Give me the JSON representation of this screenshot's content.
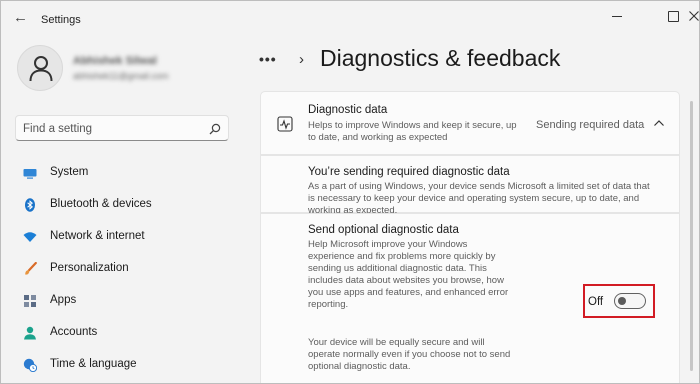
{
  "window": {
    "title": "Settings"
  },
  "profile": {
    "name": "Abhishek Silwal",
    "email": "abhishek11@gmail.com"
  },
  "search": {
    "placeholder": "Find a setting"
  },
  "sidebar": {
    "items": [
      {
        "label": "System",
        "icon": "monitor-icon",
        "color": "#2f86d6"
      },
      {
        "label": "Bluetooth & devices",
        "icon": "bluetooth-icon",
        "color": "#1a73c9"
      },
      {
        "label": "Network & internet",
        "icon": "wifi-icon",
        "color": "#1b7fd6"
      },
      {
        "label": "Personalization",
        "icon": "brush-icon",
        "color": "#e07a33"
      },
      {
        "label": "Apps",
        "icon": "apps-icon",
        "color": "#5a6b85"
      },
      {
        "label": "Accounts",
        "icon": "person-icon",
        "color": "#1aa28c"
      },
      {
        "label": "Time & language",
        "icon": "globe-clock-icon",
        "color": "#2b7bd0"
      }
    ]
  },
  "page": {
    "title": "Diagnostics & feedback"
  },
  "diagnostic_data": {
    "title": "Diagnostic data",
    "description": "Helps to improve Windows and keep it secure, up to date, and working as expected",
    "status": "Sending required data",
    "expanded": true
  },
  "required_section": {
    "title": "You’re sending required diagnostic data",
    "description": "As a part of using Windows, your device sends Microsoft a limited set of data that is necessary to keep your device and operating system secure, up to date, and working as expected."
  },
  "optional_section": {
    "title": "Send optional diagnostic data",
    "description": "Help Microsoft improve your Windows experience and fix problems more quickly by sending us additional diagnostic data. This includes data about websites you browse, how you use apps and features, and enhanced error reporting.",
    "note": "Your device will be equally secure and will operate normally even if you choose not to send optional diagnostic data.",
    "toggle_label": "Off",
    "toggle_on": false
  },
  "colors": {
    "highlight": "#d21b24",
    "background": "#f3f3f3",
    "card": "#fbfbfb"
  }
}
